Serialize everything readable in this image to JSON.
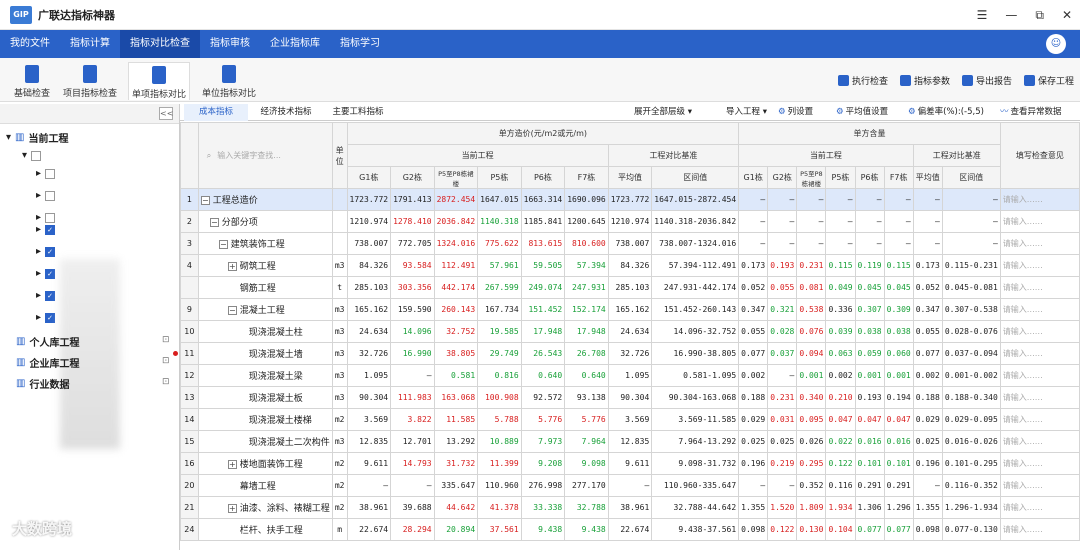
{
  "app": {
    "title": "广联达指标神器",
    "logo": "GIP"
  },
  "window_controls": [
    "☰",
    "—",
    "⧉",
    "✕"
  ],
  "nav": {
    "tabs": [
      "我的文件",
      "指标计算",
      "指标对比检查",
      "指标审核",
      "企业指标库",
      "指标学习"
    ],
    "active": 2
  },
  "toolbar": {
    "buttons": [
      "基础检查",
      "项目指标检查",
      "单项指标对比",
      "单位指标对比"
    ],
    "active": 2,
    "right": [
      "执行检查",
      "指标参数",
      "导出报告",
      "保存工程"
    ]
  },
  "sidebar": {
    "root": "当前工程",
    "others": [
      "个人库工程",
      "企业库工程",
      "行业数据"
    ],
    "collapse": "<<"
  },
  "subtabs": {
    "tabs": [
      "成本指标",
      "经济技术指标",
      "主要工料指标"
    ],
    "active": 0,
    "right": [
      "展开全部层级 ▾",
      "导入工程 ▾",
      "列设置",
      "平均值设置",
      "偏差率(%):(-5,5)",
      "查看异常数据"
    ]
  },
  "table": {
    "search_placeholder": "输入关键字查找...",
    "unit_header": "单位",
    "group1": "单方造价(元/m2或元/m)",
    "group2": "单方含量",
    "sub_current": "当前工程",
    "sub_base": "工程对比基准",
    "comment_header": "填写检查意见",
    "cols": [
      "G1栋",
      "G2栋",
      "P5至P8栋裙楼",
      "P5栋",
      "P6栋",
      "F7栋",
      "平均值",
      "区间值"
    ],
    "rows": [
      {
        "idx": "1",
        "name": "工程总造价",
        "lvl": 0,
        "exp": "−",
        "unit": "",
        "v": [
          "1723.772",
          "1791.413",
          "2872.454",
          "1647.015",
          "1663.314",
          "1690.096",
          "1723.772",
          "1647.015-2872.454"
        ],
        "c": [
          "",
          "",
          "r",
          "",
          "",
          "",
          "",
          ""
        ],
        "q": [
          "–",
          "–",
          "–",
          "–",
          "–",
          "–",
          "–",
          "–"
        ],
        "qc": [
          "",
          "",
          "",
          "",
          "",
          "",
          "",
          ""
        ],
        "sel": true
      },
      {
        "idx": "2",
        "name": "分部分项",
        "lvl": 1,
        "exp": "−",
        "unit": "",
        "v": [
          "1210.974",
          "1278.410",
          "2036.842",
          "1140.318",
          "1185.841",
          "1200.645",
          "1210.974",
          "1140.318-2036.842"
        ],
        "c": [
          "",
          "r",
          "r",
          "g",
          "",
          "",
          "",
          ""
        ],
        "q": [
          "–",
          "–",
          "–",
          "–",
          "–",
          "–",
          "–",
          "–"
        ],
        "qc": [
          "",
          "",
          "",
          "",
          "",
          "",
          "",
          ""
        ]
      },
      {
        "idx": "3",
        "name": "建筑装饰工程",
        "lvl": 2,
        "exp": "−",
        "unit": "",
        "v": [
          "738.007",
          "772.705",
          "1324.016",
          "775.622",
          "813.615",
          "810.600",
          "738.007",
          "738.007-1324.016"
        ],
        "c": [
          "",
          "",
          "r",
          "r",
          "r",
          "r",
          "",
          ""
        ],
        "q": [
          "–",
          "–",
          "–",
          "–",
          "–",
          "–",
          "–",
          "–"
        ],
        "qc": [
          "",
          "",
          "",
          "",
          "",
          "",
          "",
          ""
        ]
      },
      {
        "idx": "4",
        "name": "砌筑工程",
        "lvl": 3,
        "exp": "+",
        "unit": "m3",
        "v": [
          "84.326",
          "93.584",
          "112.491",
          "57.961",
          "59.505",
          "57.394",
          "84.326",
          "57.394-112.491"
        ],
        "c": [
          "",
          "r",
          "r",
          "g",
          "g",
          "g",
          "",
          ""
        ],
        "q": [
          "0.173",
          "0.193",
          "0.231",
          "0.115",
          "0.119",
          "0.115",
          "0.173",
          "0.115-0.231"
        ],
        "qc": [
          "",
          "r",
          "r",
          "g",
          "g",
          "g",
          "",
          ""
        ]
      },
      {
        "idx": "",
        "name": "钢筋工程",
        "lvl": 3,
        "exp": "",
        "unit": "t",
        "v": [
          "285.103",
          "303.356",
          "442.174",
          "267.599",
          "249.074",
          "247.931",
          "285.103",
          "247.931-442.174"
        ],
        "c": [
          "",
          "r",
          "r",
          "g",
          "g",
          "g",
          "",
          ""
        ],
        "q": [
          "0.052",
          "0.055",
          "0.081",
          "0.049",
          "0.045",
          "0.045",
          "0.052",
          "0.045-0.081"
        ],
        "qc": [
          "",
          "r",
          "r",
          "g",
          "g",
          "g",
          "",
          ""
        ]
      },
      {
        "idx": "9",
        "name": "混凝土工程",
        "lvl": 3,
        "exp": "−",
        "unit": "m3",
        "v": [
          "165.162",
          "159.590",
          "260.143",
          "167.734",
          "151.452",
          "152.174",
          "165.162",
          "151.452-260.143"
        ],
        "c": [
          "",
          "",
          "r",
          "",
          "g",
          "g",
          "",
          ""
        ],
        "q": [
          "0.347",
          "0.321",
          "0.538",
          "0.336",
          "0.307",
          "0.309",
          "0.347",
          "0.307-0.538"
        ],
        "qc": [
          "",
          "g",
          "r",
          "",
          "g",
          "g",
          "",
          ""
        ]
      },
      {
        "idx": "10",
        "name": "现浇混凝土柱",
        "lvl": 4,
        "exp": "",
        "unit": "m3",
        "v": [
          "24.634",
          "14.096",
          "32.752",
          "19.585",
          "17.948",
          "17.948",
          "24.634",
          "14.096-32.752"
        ],
        "c": [
          "",
          "g",
          "r",
          "g",
          "g",
          "g",
          "",
          ""
        ],
        "q": [
          "0.055",
          "0.028",
          "0.076",
          "0.039",
          "0.038",
          "0.038",
          "0.055",
          "0.028-0.076"
        ],
        "qc": [
          "",
          "g",
          "r",
          "g",
          "g",
          "g",
          "",
          ""
        ]
      },
      {
        "idx": "11",
        "name": "现浇混凝土墙",
        "lvl": 4,
        "exp": "",
        "unit": "m3",
        "v": [
          "32.726",
          "16.990",
          "38.805",
          "29.749",
          "26.543",
          "26.708",
          "32.726",
          "16.990-38.805"
        ],
        "c": [
          "",
          "g",
          "r",
          "g",
          "g",
          "g",
          "",
          ""
        ],
        "q": [
          "0.077",
          "0.037",
          "0.094",
          "0.063",
          "0.059",
          "0.060",
          "0.077",
          "0.037-0.094"
        ],
        "qc": [
          "",
          "g",
          "r",
          "g",
          "g",
          "g",
          "",
          ""
        ]
      },
      {
        "idx": "12",
        "name": "现浇混凝土梁",
        "lvl": 4,
        "exp": "",
        "unit": "m3",
        "v": [
          "1.095",
          "–",
          "0.581",
          "0.816",
          "0.640",
          "0.640",
          "1.095",
          "0.581-1.095"
        ],
        "c": [
          "",
          "",
          "g",
          "g",
          "g",
          "g",
          "",
          ""
        ],
        "q": [
          "0.002",
          "–",
          "0.001",
          "0.002",
          "0.001",
          "0.001",
          "0.002",
          "0.001-0.002"
        ],
        "qc": [
          "",
          "",
          "g",
          "",
          "g",
          "g",
          "",
          ""
        ]
      },
      {
        "idx": "13",
        "name": "现浇混凝土板",
        "lvl": 4,
        "exp": "",
        "unit": "m3",
        "v": [
          "90.304",
          "111.983",
          "163.068",
          "100.908",
          "92.572",
          "93.138",
          "90.304",
          "90.304-163.068"
        ],
        "c": [
          "",
          "r",
          "r",
          "r",
          "",
          "",
          "",
          ""
        ],
        "q": [
          "0.188",
          "0.231",
          "0.340",
          "0.210",
          "0.193",
          "0.194",
          "0.188",
          "0.188-0.340"
        ],
        "qc": [
          "",
          "r",
          "r",
          "r",
          "",
          "",
          " ",
          ""
        ]
      },
      {
        "idx": "14",
        "name": "现浇混凝土楼梯",
        "lvl": 4,
        "exp": "",
        "unit": "m2",
        "v": [
          "3.569",
          "3.822",
          "11.585",
          "5.788",
          "5.776",
          "5.776",
          "3.569",
          "3.569-11.585"
        ],
        "c": [
          "",
          "r",
          "r",
          "r",
          "r",
          "r",
          "",
          ""
        ],
        "q": [
          "0.029",
          "0.031",
          "0.095",
          "0.047",
          "0.047",
          "0.047",
          "0.029",
          "0.029-0.095"
        ],
        "qc": [
          "",
          "r",
          "r",
          "r",
          "r",
          "r",
          "",
          ""
        ]
      },
      {
        "idx": "15",
        "name": "现浇混凝土二次构件",
        "lvl": 4,
        "exp": "",
        "unit": "m3",
        "v": [
          "12.835",
          "12.701",
          "13.292",
          "10.889",
          "7.973",
          "7.964",
          "12.835",
          "7.964-13.292"
        ],
        "c": [
          "",
          "",
          "",
          "g",
          "g",
          "g",
          "",
          ""
        ],
        "q": [
          "0.025",
          "0.025",
          "0.026",
          "0.022",
          "0.016",
          "0.016",
          "0.025",
          "0.016-0.026"
        ],
        "qc": [
          "",
          "",
          "",
          "g",
          "g",
          "g",
          "",
          ""
        ]
      },
      {
        "idx": "16",
        "name": "楼地面装饰工程",
        "lvl": 3,
        "exp": "+",
        "unit": "m2",
        "v": [
          "9.611",
          "14.793",
          "31.732",
          "11.399",
          "9.208",
          "9.098",
          "9.611",
          "9.098-31.732"
        ],
        "c": [
          "",
          "r",
          "r",
          "r",
          "g",
          "g",
          "",
          ""
        ],
        "q": [
          "0.196",
          "0.219",
          "0.295",
          "0.122",
          "0.101",
          "0.101",
          "0.196",
          "0.101-0.295"
        ],
        "qc": [
          "",
          "r",
          "r",
          "g",
          "g",
          "g",
          "",
          ""
        ]
      },
      {
        "idx": "20",
        "name": "幕墙工程",
        "lvl": 3,
        "exp": "",
        "unit": "m2",
        "v": [
          "–",
          "–",
          "335.647",
          "110.960",
          "276.998",
          "277.170",
          "–",
          "110.960-335.647"
        ],
        "c": [
          "",
          "",
          "",
          "",
          "",
          "",
          "",
          ""
        ],
        "q": [
          "–",
          "–",
          "0.352",
          "0.116",
          "0.291",
          "0.291",
          "–",
          "0.116-0.352"
        ],
        "qc": [
          "",
          "",
          "",
          "",
          "",
          "",
          "",
          ""
        ]
      },
      {
        "idx": "21",
        "name": "油漆、涂料、裱糊工程",
        "lvl": 3,
        "exp": "+",
        "unit": "m2",
        "v": [
          "38.961",
          "39.688",
          "44.642",
          "41.378",
          "33.338",
          "32.788",
          "38.961",
          "32.788-44.642"
        ],
        "c": [
          "",
          "",
          "r",
          "r",
          "g",
          "g",
          "",
          ""
        ],
        "q": [
          "1.355",
          "1.520",
          "1.809",
          "1.934",
          "1.306",
          "1.296",
          "1.355",
          "1.296-1.934"
        ],
        "qc": [
          "",
          "r",
          "r",
          "r",
          "",
          "",
          " ",
          ""
        ]
      },
      {
        "idx": "24",
        "name": "栏杆、扶手工程",
        "lvl": 3,
        "exp": "",
        "unit": "m",
        "v": [
          "22.674",
          "28.294",
          "20.894",
          "37.561",
          "9.438",
          "9.438",
          "22.674",
          "9.438-37.561"
        ],
        "c": [
          "",
          "r",
          "g",
          "r",
          "g",
          "g",
          "",
          ""
        ],
        "q": [
          "0.098",
          "0.122",
          "0.130",
          "0.104",
          "0.077",
          "0.077",
          "0.098",
          "0.077-0.130"
        ],
        "qc": [
          "",
          "r",
          "r",
          "r",
          "g",
          "g",
          "",
          ""
        ]
      }
    ],
    "comment_placeholder": "请输入……"
  },
  "watermark": "大数跨境",
  "colors": {
    "nav": "#2a62c8",
    "red": "#d81e1e",
    "green": "#18a038"
  }
}
